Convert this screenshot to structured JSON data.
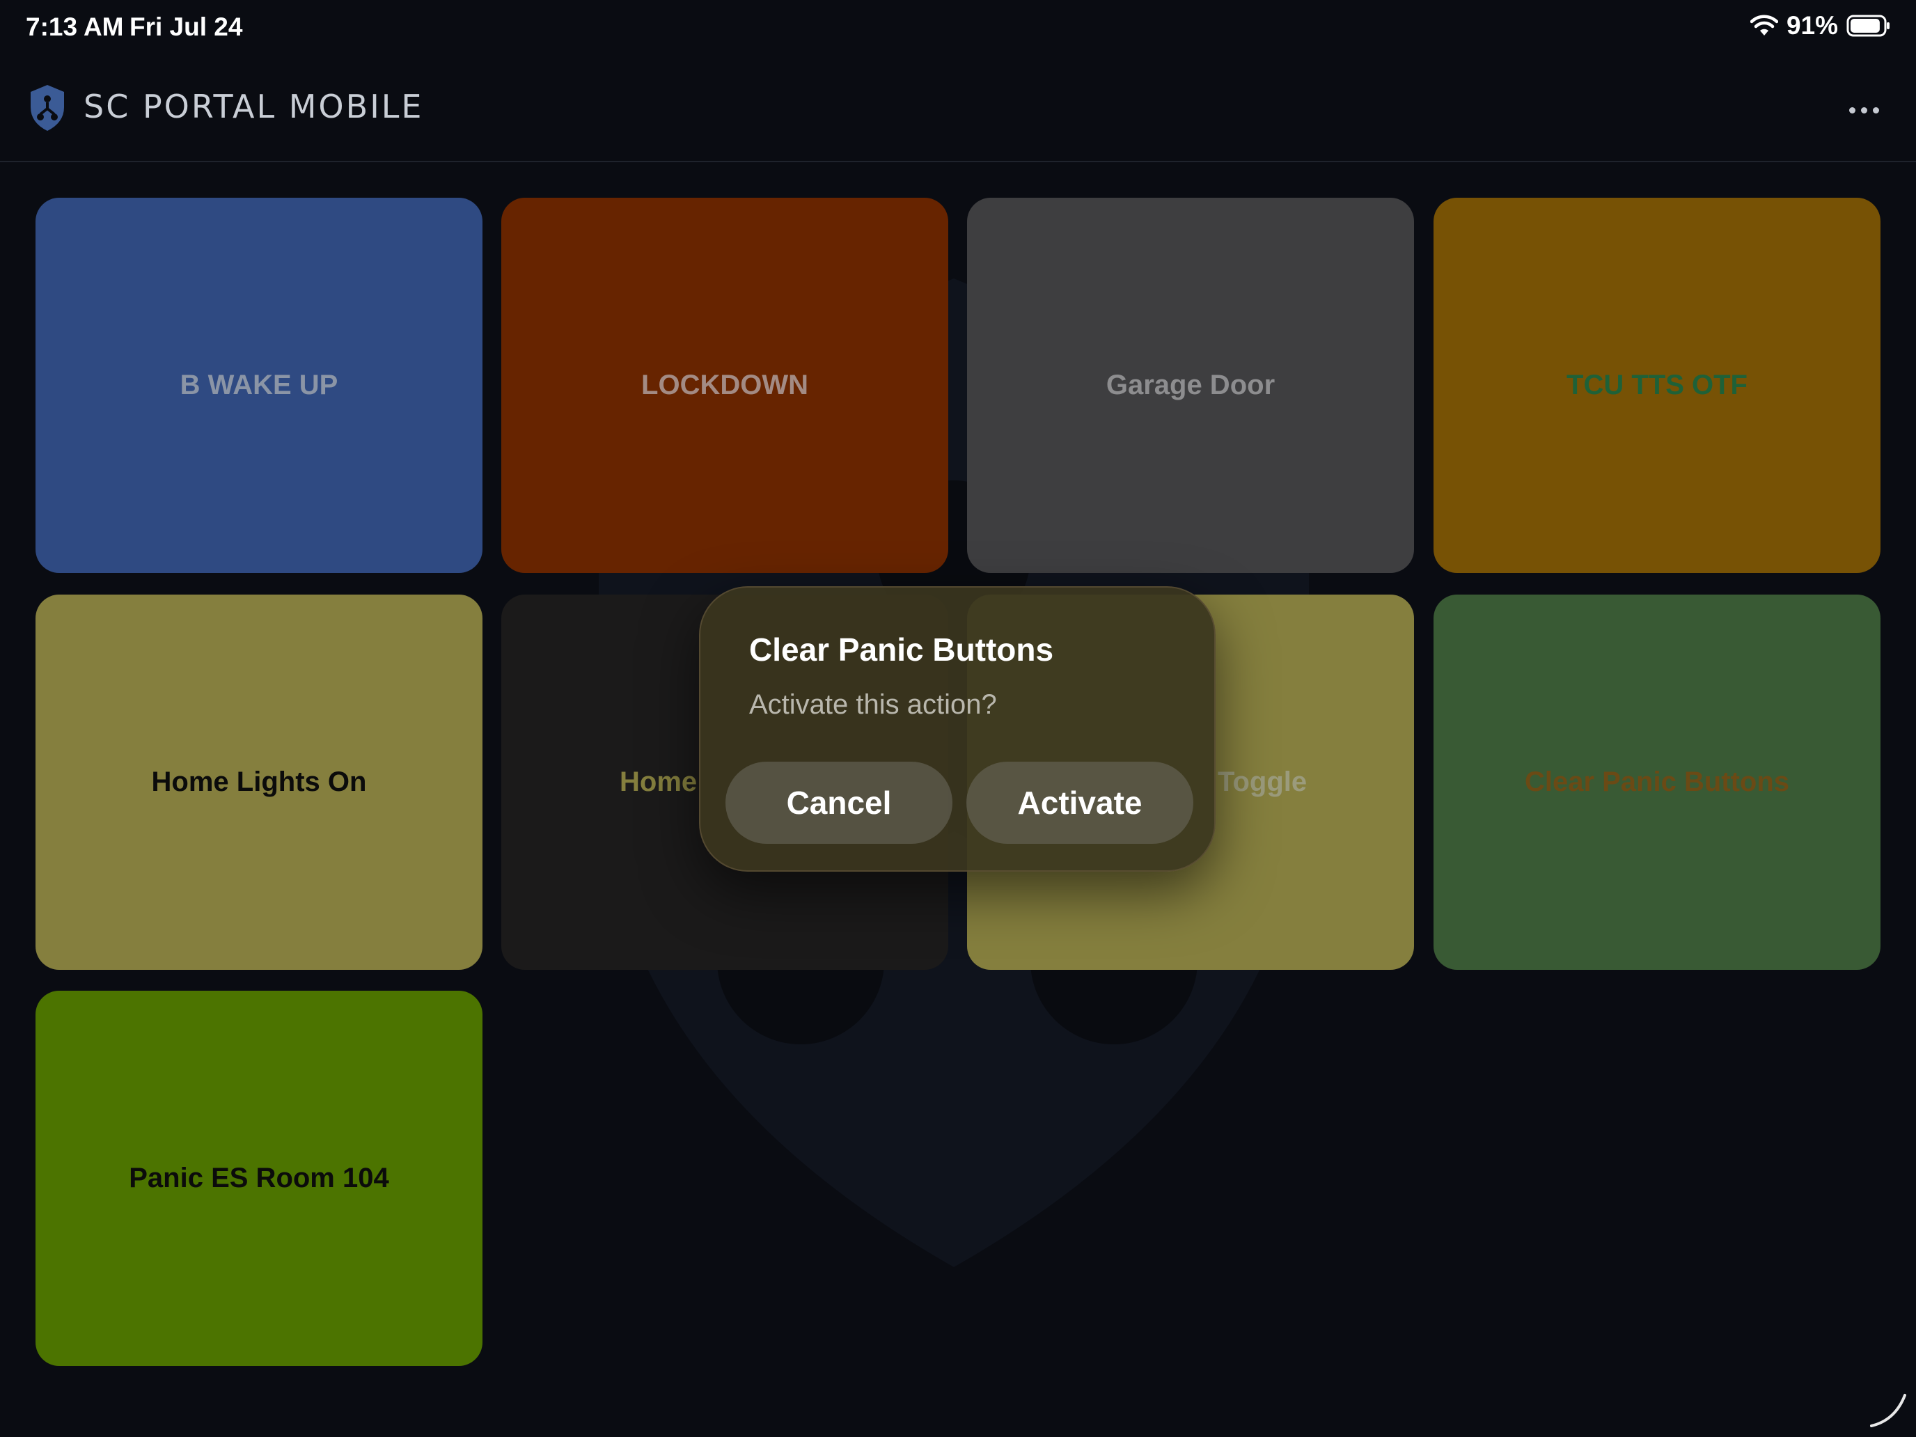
{
  "status_bar": {
    "time": "7:13 AM",
    "date": "Fri Jul 24",
    "battery_percent": "91%",
    "battery_level": 0.91,
    "icons": [
      "wifi-icon",
      "battery-icon"
    ]
  },
  "header": {
    "title": "SC PORTAL MOBILE",
    "logo_icon": "shield-logo-icon",
    "menu_icon": "more-dots-icon"
  },
  "tiles": [
    {
      "label": "B WAKE UP",
      "bg": "#2f4a82",
      "fg": "#8b95a6"
    },
    {
      "label": "LOCKDOWN",
      "bg": "#672400",
      "fg": "#a38b84"
    },
    {
      "label": "Garage Door",
      "bg": "#3e3e40",
      "fg": "#8d8d8f"
    },
    {
      "label": "TCU TTS OTF",
      "bg": "#775205",
      "fg": "#1e6138"
    },
    {
      "label": "Home Lights On",
      "bg": "#857f3e",
      "fg": "#0b0b0b"
    },
    {
      "label": "Home",
      "bg": "#1b1a1a",
      "fg": "#857f3e"
    },
    {
      "label": "Toggle",
      "bg": "#857f3e",
      "fg": "#9b9b7c"
    },
    {
      "label": "Clear Panic Buttons",
      "bg": "#395a34",
      "fg": "#6b4a15"
    },
    {
      "label": "Panic ES Room 104",
      "bg": "#4c7400",
      "fg": "#0b0b0b"
    }
  ],
  "dialog": {
    "title": "Clear Panic Buttons",
    "message": "Activate this action?",
    "cancel_label": "Cancel",
    "activate_label": "Activate"
  }
}
